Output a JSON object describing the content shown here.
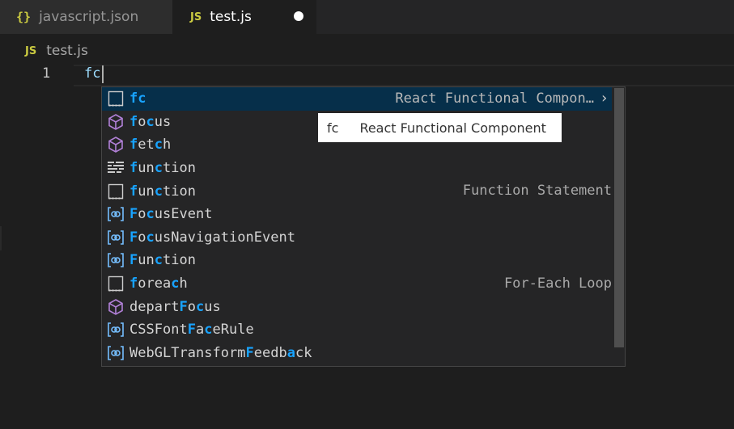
{
  "tabs": [
    {
      "icon": "{}",
      "icon_name": "json-braces-icon",
      "label": "javascript.json"
    },
    {
      "icon": "JS",
      "icon_name": "js-file-icon",
      "label": "test.js",
      "dirty": true
    }
  ],
  "breadcrumb": {
    "icon": "JS",
    "label": "test.js"
  },
  "editor": {
    "line_number": "1",
    "code": "fc"
  },
  "suggest": {
    "items": [
      {
        "icon": "snippet-icon",
        "label": "fc",
        "matches": [
          0,
          1
        ],
        "detail": "React Functional Compon…",
        "selected": true
      },
      {
        "icon": "module-icon",
        "label": "focus",
        "matches": [
          0,
          2
        ],
        "detail": ""
      },
      {
        "icon": "module-icon",
        "label": "fetch",
        "matches": [
          0,
          3
        ],
        "detail": ""
      },
      {
        "icon": "keyword-icon",
        "label": "function",
        "matches": [
          0,
          3
        ],
        "detail": ""
      },
      {
        "icon": "snippet-icon",
        "label": "function",
        "matches": [
          0,
          3
        ],
        "detail": "Function Statement"
      },
      {
        "icon": "interface-icon",
        "label": "FocusEvent",
        "matches": [
          0,
          2
        ],
        "detail": ""
      },
      {
        "icon": "interface-icon",
        "label": "FocusNavigationEvent",
        "matches": [
          0,
          2
        ],
        "detail": ""
      },
      {
        "icon": "interface-icon",
        "label": "Function",
        "matches": [
          0,
          3
        ],
        "detail": ""
      },
      {
        "icon": "snippet-icon",
        "label": "foreach",
        "matches": [
          0,
          5
        ],
        "detail": "For-Each Loop"
      },
      {
        "icon": "module-icon",
        "label": "departFocus",
        "matches": [
          6,
          8
        ],
        "detail": ""
      },
      {
        "icon": "interface-icon",
        "label": "CSSFontFaceRule",
        "matches": [
          7,
          9
        ],
        "detail": ""
      },
      {
        "icon": "interface-icon",
        "label": "WebGLTransformFeedback",
        "matches": [
          14,
          19
        ],
        "detail": ""
      }
    ]
  },
  "doc_popup": {
    "prefix": "fc",
    "text": "React Functional Component"
  },
  "colors": {
    "match": "#18a3ff",
    "selected_bg": "#062f4a",
    "module_icon": "#b180d7",
    "interface_icon": "#75beff"
  }
}
